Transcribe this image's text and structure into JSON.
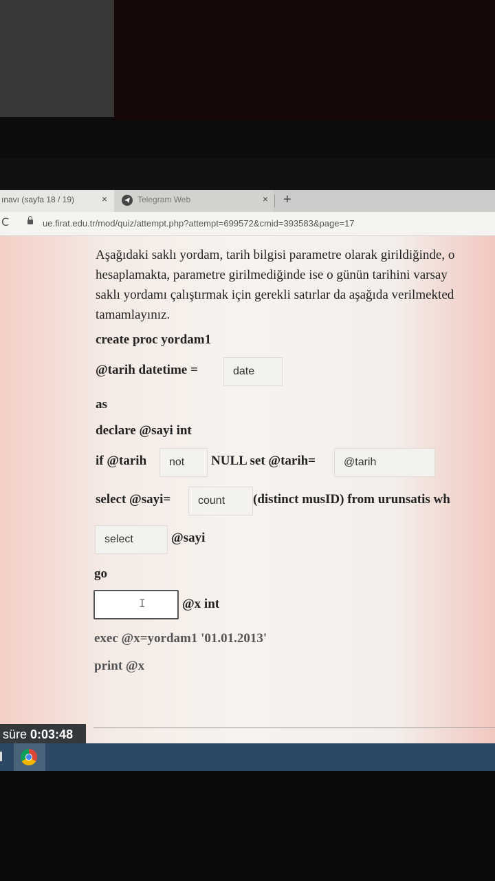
{
  "tabs": [
    {
      "title": "ınavı (sayfa 18 / 19)",
      "close": "×"
    },
    {
      "title": "Telegram Web",
      "close": "×"
    }
  ],
  "newtab": "+",
  "reload_icon": "C",
  "url": "ue.firat.edu.tr/mod/quiz/attempt.php?attempt=699572&cmid=393583&page=17",
  "question": {
    "lines": [
      "Aşağıdaki saklı yordam, tarih bilgisi parametre olarak girildiğinde, o",
      "hesaplamakta, parametre girilmediğinde ise o günün tarihini varsay",
      "saklı yordamı çalıştırmak için gerekli satırlar da aşağıda verilmekted",
      "tamamlayınız."
    ],
    "create": "create proc yordam1",
    "tarih_prefix": "@tarih datetime =",
    "blank_date": "date",
    "as": "as",
    "declare": "declare @sayi int",
    "if_prefix": "if @tarih",
    "blank_not": "not",
    "if_mid": "NULL set @tarih=",
    "blank_tarih": "@tarih",
    "select_prefix": "select @sayi=",
    "blank_count": "count",
    "select_suffix": "(distinct musID) from urunsatis wh",
    "blank_select": "select",
    "sayi_suffix": "@sayi",
    "go": "go",
    "x_suffix": "@x int",
    "exec": "exec @x=yordam1 '01.01.2013'",
    "print": "print @x"
  },
  "timer": {
    "label": "süre",
    "value": "0:03:48"
  }
}
